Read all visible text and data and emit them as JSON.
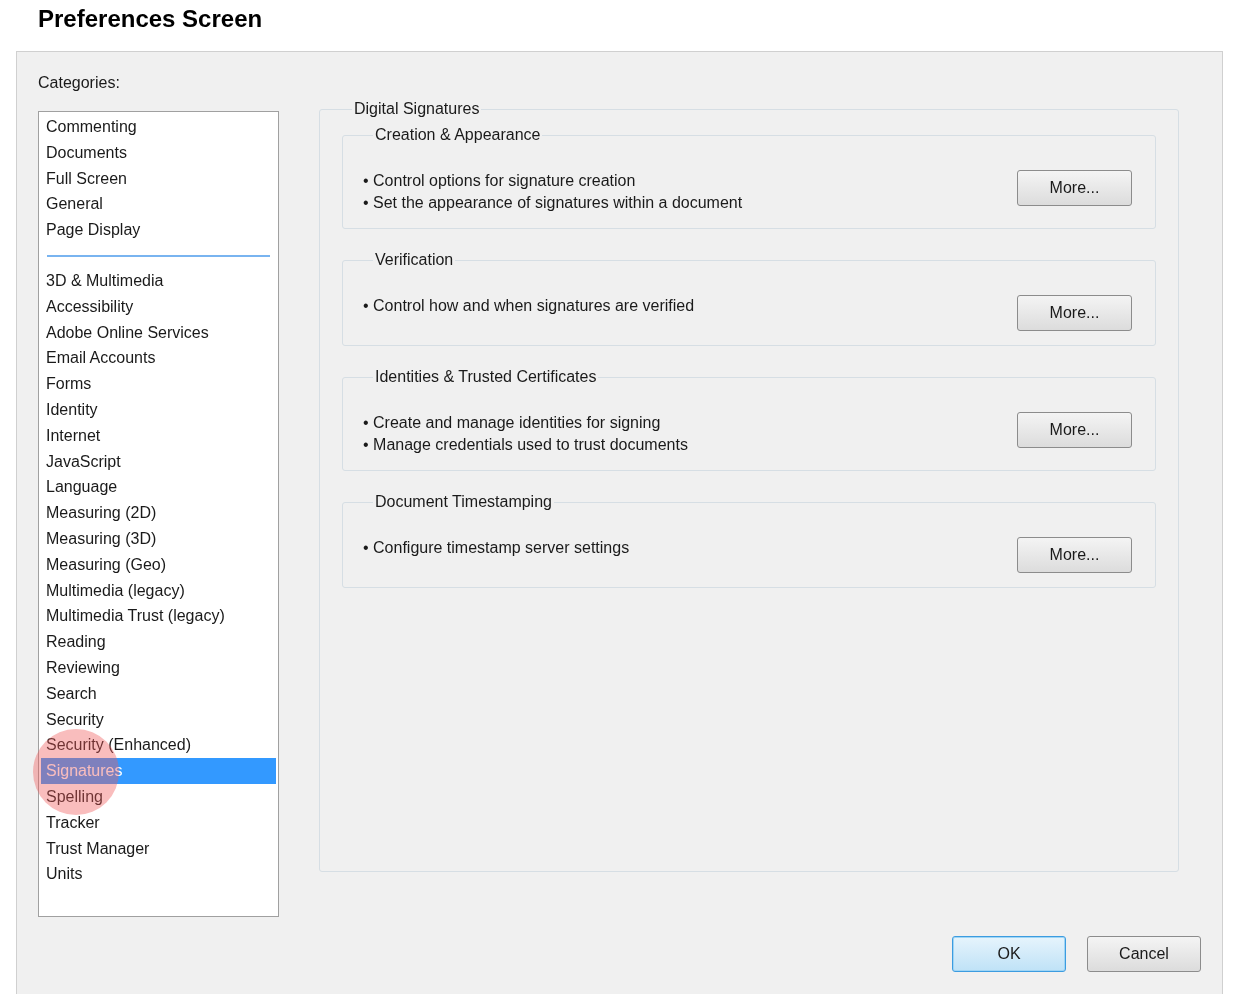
{
  "page_title": "Preferences Screen",
  "categories": {
    "label": "Categories:",
    "groups": [
      {
        "items": [
          {
            "label": "Commenting",
            "selected": false
          },
          {
            "label": "Documents",
            "selected": false
          },
          {
            "label": "Full Screen",
            "selected": false
          },
          {
            "label": "General",
            "selected": false
          },
          {
            "label": "Page Display",
            "selected": false
          }
        ]
      },
      {
        "items": [
          {
            "label": "3D & Multimedia",
            "selected": false
          },
          {
            "label": "Accessibility",
            "selected": false
          },
          {
            "label": "Adobe Online Services",
            "selected": false
          },
          {
            "label": "Email Accounts",
            "selected": false
          },
          {
            "label": "Forms",
            "selected": false
          },
          {
            "label": "Identity",
            "selected": false
          },
          {
            "label": "Internet",
            "selected": false
          },
          {
            "label": "JavaScript",
            "selected": false
          },
          {
            "label": "Language",
            "selected": false
          },
          {
            "label": "Measuring (2D)",
            "selected": false
          },
          {
            "label": "Measuring (3D)",
            "selected": false
          },
          {
            "label": "Measuring (Geo)",
            "selected": false
          },
          {
            "label": "Multimedia (legacy)",
            "selected": false
          },
          {
            "label": "Multimedia Trust (legacy)",
            "selected": false
          },
          {
            "label": "Reading",
            "selected": false
          },
          {
            "label": "Reviewing",
            "selected": false
          },
          {
            "label": "Search",
            "selected": false
          },
          {
            "label": "Security",
            "selected": false
          },
          {
            "label": "Security (Enhanced)",
            "selected": false
          },
          {
            "label": "Signatures",
            "selected": true
          },
          {
            "label": "Spelling",
            "selected": false
          },
          {
            "label": "Tracker",
            "selected": false
          },
          {
            "label": "Trust Manager",
            "selected": false
          },
          {
            "label": "Units",
            "selected": false
          }
        ]
      }
    ]
  },
  "panel": {
    "title": "Digital Signatures",
    "sections": [
      {
        "title": "Creation & Appearance",
        "bullets": [
          "• Control options for signature creation",
          "• Set the appearance of signatures within a document"
        ],
        "button": "More..."
      },
      {
        "title": "Verification",
        "bullets": [
          "• Control how and when signatures are verified"
        ],
        "button": "More..."
      },
      {
        "title": "Identities & Trusted Certificates",
        "bullets": [
          "• Create and manage identities for signing",
          "• Manage credentials used to trust documents"
        ],
        "button": "More..."
      },
      {
        "title": "Document Timestamping",
        "bullets": [
          "• Configure timestamp server settings"
        ],
        "button": "More..."
      }
    ]
  },
  "buttons": [
    {
      "label": "OK",
      "default": true
    },
    {
      "label": "Cancel",
      "default": false
    }
  ]
}
